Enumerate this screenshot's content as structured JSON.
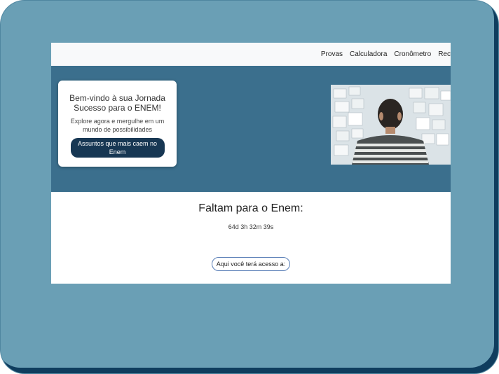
{
  "nav": {
    "items": [
      "Provas",
      "Calculadora",
      "Cronômetro",
      "Rec"
    ]
  },
  "hero": {
    "card": {
      "title": "Bem-vindo à sua Jornada Sucesso para o ENEM!",
      "text": "Explore agora e mergulhe em um mundo de possibilidades",
      "button_label": "Assuntos que mais caem no Enem"
    }
  },
  "countdown": {
    "title": "Faltam para o Enem:",
    "value": "64d 3h 32m 39s"
  },
  "access": {
    "label": "Aqui você terá acesso a:"
  },
  "colors": {
    "frame": "#6a9fb5",
    "hero_bg": "#3b6f8d",
    "button": "#173753",
    "navbar_bg": "#f8f9fa"
  }
}
